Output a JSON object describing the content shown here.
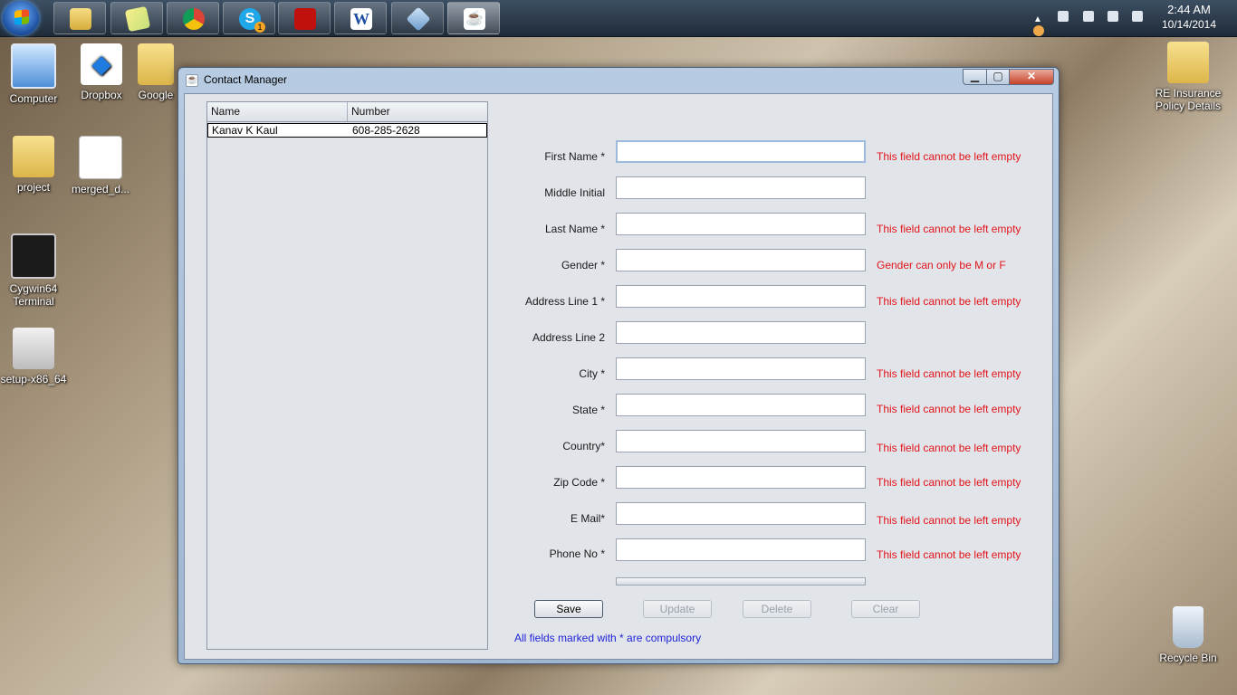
{
  "taskbar": {
    "clock_time": "2:44 AM",
    "clock_date": "10/14/2014",
    "pinned": [
      "file-explorer-icon",
      "sticky-notes-icon",
      "chrome-icon",
      "skype-icon",
      "acrobat-icon",
      "word-icon",
      "virtualbox-icon",
      "java-icon"
    ],
    "skype_badge": "1"
  },
  "desktop": {
    "icons": [
      {
        "label": "Computer"
      },
      {
        "label": "Dropbox"
      },
      {
        "label": "Google"
      },
      {
        "label": "project"
      },
      {
        "label": "merged_d..."
      },
      {
        "label": "Cygwin64 Terminal"
      },
      {
        "label": "setup-x86_64"
      },
      {
        "label": "RE Insurance Policy Details"
      },
      {
        "label": "Recycle Bin"
      }
    ]
  },
  "window": {
    "title": "Contact Manager",
    "controls": {
      "minimize": "▁",
      "maximize": "▢",
      "close": "✕"
    }
  },
  "table": {
    "headers": [
      "Name",
      "Number"
    ],
    "rows": [
      {
        "name": "Kanav K Kaul",
        "number": "608-285-2628"
      }
    ]
  },
  "form": {
    "fields": [
      {
        "label": "First Name *",
        "value": "",
        "error": "This field cannot be left empty"
      },
      {
        "label": "Middle Initial",
        "value": "",
        "error": ""
      },
      {
        "label": "Last Name *",
        "value": "",
        "error": "This field cannot be left empty"
      },
      {
        "label": "Gender *",
        "value": "",
        "error": "Gender can only be M or F"
      },
      {
        "label": "Address Line 1 *",
        "value": "",
        "error": "This field cannot be left empty"
      },
      {
        "label": "Address Line 2",
        "value": "",
        "error": ""
      },
      {
        "label": "City *",
        "value": "",
        "error": "This field cannot be left empty"
      },
      {
        "label": "State *",
        "value": "",
        "error": "This field cannot be left empty"
      },
      {
        "label": "Country*",
        "value": "",
        "error": "This field cannot be left empty"
      },
      {
        "label": "Zip Code *",
        "value": "",
        "error": "This field cannot be left empty"
      },
      {
        "label": "E Mail*",
        "value": "",
        "error": "This field cannot be left empty"
      },
      {
        "label": "Phone No *",
        "value": "",
        "error": "This field cannot be left empty"
      }
    ],
    "progress": 0
  },
  "buttons": {
    "save": "Save",
    "update": "Update",
    "delete": "Delete",
    "clear": "Clear"
  },
  "note": "All fields marked with * are compulsory",
  "colors": {
    "error": "#e2141a",
    "note": "#1f23d8",
    "window_client": "#e1e4e9"
  }
}
